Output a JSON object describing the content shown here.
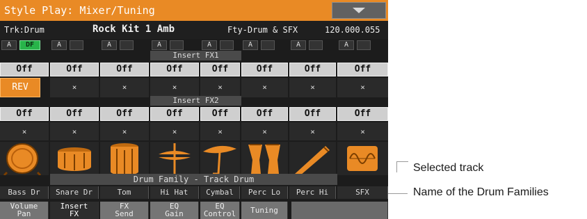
{
  "title": "Style Play: Mixer/Tuning",
  "header": {
    "track": "Trk:Drum",
    "kit": "Rock Kit 1 Amb",
    "category": "Fty-Drum & SFX",
    "bank": "120.000.055"
  },
  "mode_labels": {
    "a": "A",
    "df": "DF"
  },
  "insert_fx1_label": "Insert FX1",
  "insert_fx2_label": "Insert FX2",
  "off_label": "Off",
  "empty_label": "×",
  "rev_label": "REV",
  "family_label": "Drum Family - Track Drum",
  "channels": [
    {
      "name": "Bass Dr",
      "icon": "bass-drum-icon"
    },
    {
      "name": "Snare Dr",
      "icon": "snare-drum-icon"
    },
    {
      "name": "Tom",
      "icon": "tom-icon"
    },
    {
      "name": "Hi Hat",
      "icon": "hi-hat-icon"
    },
    {
      "name": "Cymbal",
      "icon": "cymbal-icon"
    },
    {
      "name": "Perc Lo",
      "icon": "conga-icon"
    },
    {
      "name": "Perc Hi",
      "icon": "shaker-icon"
    },
    {
      "name": "SFX",
      "icon": "sfx-wave-icon"
    }
  ],
  "tabs": [
    {
      "line1": "Volume",
      "line2": "Pan"
    },
    {
      "line1": "Insert",
      "line2": "FX"
    },
    {
      "line1": "FX",
      "line2": "Send"
    },
    {
      "line1": "EQ",
      "line2": "Gain"
    },
    {
      "line1": "EQ",
      "line2": "Control"
    },
    {
      "line1": "Tuning",
      "line2": ""
    }
  ],
  "active_tab": 1,
  "callouts": {
    "selected_track": "Selected track",
    "drum_families": "Name of the Drum Families"
  },
  "colors": {
    "accent": "#e98a25",
    "df_green": "#28b44a",
    "button_gray": "#cfcfcf"
  }
}
